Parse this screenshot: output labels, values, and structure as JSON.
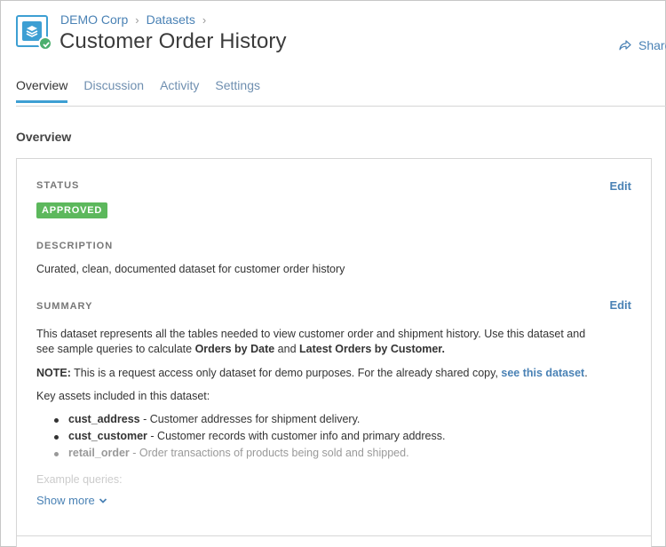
{
  "header": {
    "breadcrumb": [
      "DEMO Corp",
      "Datasets"
    ],
    "title": "Customer Order History",
    "share_label": "Share"
  },
  "tabs": [
    "Overview",
    "Discussion",
    "Activity",
    "Settings"
  ],
  "active_tab": "Overview",
  "section_title": "Overview",
  "status": {
    "label": "STATUS",
    "value": "APPROVED",
    "edit_label": "Edit"
  },
  "description": {
    "label": "DESCRIPTION",
    "text": "Curated, clean, documented dataset for customer order history"
  },
  "summary": {
    "label": "SUMMARY",
    "edit_label": "Edit",
    "p1_line1": "This dataset represents all the tables needed to view customer order and shipment history. Use this dataset and",
    "p1_line2_prefix": "see sample queries to calculate ",
    "p1_bold1": "Orders by Date",
    "p1_and": " and ",
    "p1_bold2": "Latest Orders by Customer.",
    "note_bold": "NOTE:",
    "note_text": " This is a request access only dataset for demo purposes. For the already shared copy, ",
    "note_link": "see this dataset",
    "note_end": ".",
    "key_assets_intro": "Key assets included in this dataset:",
    "assets": [
      {
        "name": "cust_address",
        "desc": " - Customer addresses for shipment delivery."
      },
      {
        "name": "cust_customer",
        "desc": " - Customer records with customer info and primary address."
      },
      {
        "name": "retail_order",
        "desc": " - Order transactions of products being sold and shipped."
      }
    ],
    "example_queries": "Example queries:",
    "show_more": "Show more"
  },
  "colors": {
    "accent": "#3d9fd3",
    "link": "#4a82b5",
    "approved": "#5cb85c"
  }
}
